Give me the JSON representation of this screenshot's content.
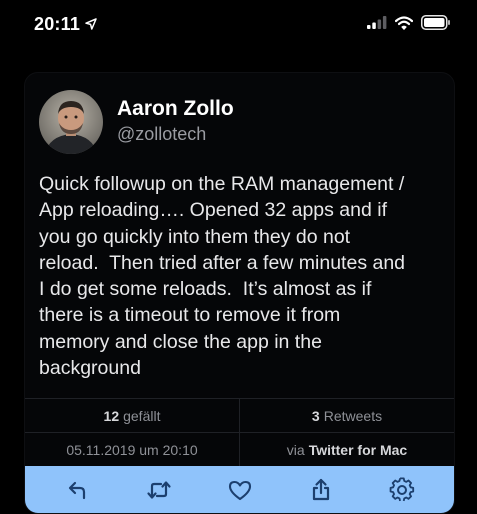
{
  "status_bar": {
    "time": "20:11",
    "icons": [
      "location-arrow-icon",
      "cellular-signal-icon",
      "wifi-icon",
      "battery-icon"
    ]
  },
  "tweet": {
    "author_name": "Aaron Zollo",
    "author_handle": "@zollotech",
    "avatar_icon": "avatar",
    "text_lines": [
      "Quick followup on the RAM management /",
      "App reloading…. Opened 32 apps and if",
      "you go quickly into them they do not",
      "reload.  Then tried after a few minutes and",
      "I do get some reloads.  It’s almost as if",
      "there is a timeout to remove it from",
      "memory and close the app in the",
      "background"
    ],
    "likes_count": "12",
    "likes_label": "gefällt",
    "retweets_count": "3",
    "retweets_label": "Retweets",
    "timestamp": "05.11.2019 um 20:10",
    "via_label": "via",
    "client": "Twitter for Mac"
  },
  "toolbar": {
    "background": "#8fc3fb",
    "icon_color": "#1c3f6e",
    "actions": [
      "reply-icon",
      "retweet-icon",
      "like-icon",
      "share-icon",
      "settings-icon"
    ]
  }
}
